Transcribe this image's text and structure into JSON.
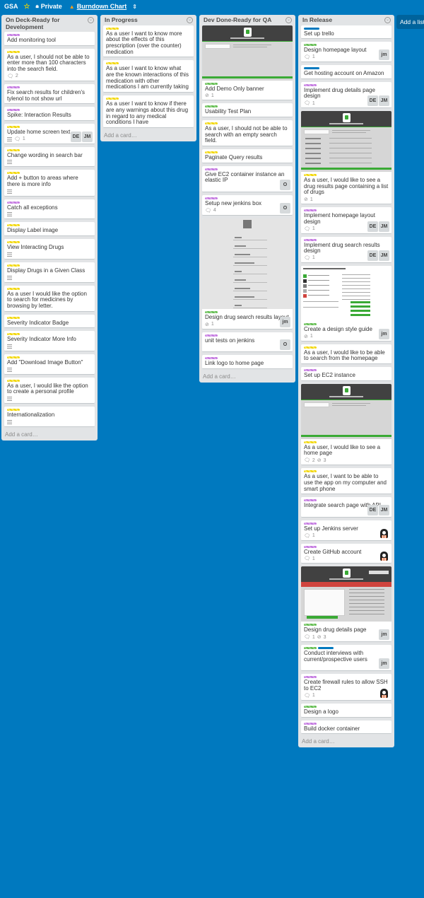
{
  "board": {
    "name": "GSA",
    "visibility": "Private",
    "burndown": "Burndown Chart",
    "add_list": "Add a list..."
  },
  "add_card_label": "Add a card…",
  "lists": [
    {
      "title": "On Deck-Ready for Development",
      "cards": [
        {
          "labels": [
            "purple"
          ],
          "title": "Add monitoring tool"
        },
        {
          "labels": [
            "yellow"
          ],
          "title": "As a user, I should not be able to enter more than 100 characters into the search field.",
          "badges": {
            "comments": "2"
          }
        },
        {
          "labels": [
            "purple"
          ],
          "title": "Fix search results for children's tylenol to not show url"
        },
        {
          "labels": [
            "purple"
          ],
          "title": "Spike: Interaction Results"
        },
        {
          "labels": [
            "yellow"
          ],
          "title": "Update home screen text",
          "badges": {
            "desc": true,
            "comments": "1"
          },
          "members": [
            "DE",
            "JM"
          ]
        },
        {
          "labels": [
            "yellow"
          ],
          "title": "Change wording in search bar",
          "badges": {
            "desc": true
          }
        },
        {
          "labels": [
            "yellow"
          ],
          "title": "Add + button to areas where there is more info",
          "badges": {
            "desc": true
          }
        },
        {
          "labels": [
            "purple"
          ],
          "title": "Catch all exceptions",
          "badges": {
            "desc": true
          }
        },
        {
          "labels": [
            "yellow"
          ],
          "title": "Display Label image"
        },
        {
          "labels": [
            "yellow"
          ],
          "title": "View Interacting Drugs",
          "badges": {
            "desc": true
          }
        },
        {
          "labels": [
            "yellow"
          ],
          "title": "Display Drugs in a Given Class",
          "badges": {
            "desc": true
          }
        },
        {
          "labels": [
            "yellow"
          ],
          "title": "As a user I would like the option to search for medicines by browsing by letter."
        },
        {
          "labels": [
            "yellow"
          ],
          "title": "Severity Indicator Badge"
        },
        {
          "labels": [
            "yellow"
          ],
          "title": "Severity Indicator More Info",
          "badges": {
            "desc": true
          }
        },
        {
          "labels": [
            "yellow"
          ],
          "title": "Add \"Download Image Button\"",
          "badges": {
            "desc": true
          }
        },
        {
          "labels": [
            "yellow"
          ],
          "title": "As a user, I would like the option to create a personal profile",
          "badges": {
            "desc": true
          }
        },
        {
          "labels": [
            "yellow"
          ],
          "title": "Internationalization",
          "badges": {
            "desc": true
          }
        }
      ]
    },
    {
      "title": "In Progress",
      "cards": [
        {
          "labels": [
            "yellow"
          ],
          "title": "As a user I want to know more about the effects of this prescription (over the counter) medication"
        },
        {
          "labels": [
            "yellow"
          ],
          "title": "As a user I want to know what are the known interactions of this medication with other medications I am currently taking"
        },
        {
          "labels": [
            "yellow"
          ],
          "title": "As a user I want to know if there are any warnings about this drug in regard to any medical conditions I have"
        }
      ]
    },
    {
      "title": "Dev Done-Ready for QA",
      "cards": [
        {
          "cover": "home",
          "labels": [
            "green"
          ],
          "title": "Add Demo Only banner",
          "badges": {
            "attach": "1"
          }
        },
        {
          "labels": [
            "green"
          ],
          "title": "Usability Test Plan"
        },
        {
          "labels": [
            "yellow"
          ],
          "title": "As a user, I should not be able to search with an empty search field."
        },
        {
          "labels": [
            "yellow"
          ],
          "title": "Paginate Query results"
        },
        {
          "labels": [
            "purple"
          ],
          "title": "Give EC2 container instance an elastic IP",
          "members": [
            "O"
          ]
        },
        {
          "labels": [
            "purple"
          ],
          "title": "Setup new jenkins box",
          "badges": {
            "comments": "4"
          },
          "members": [
            "O"
          ]
        },
        {
          "cover": "mobile",
          "labels": [
            "green"
          ],
          "title": "Design drug search results layout",
          "badges": {
            "attach": "1"
          },
          "members": [
            "jm"
          ]
        },
        {
          "labels": [
            "purple"
          ],
          "title": "unit tests on jenkins",
          "members": [
            "O"
          ]
        },
        {
          "labels": [
            "purple"
          ],
          "title": "Link logo to home page"
        }
      ]
    },
    {
      "title": "In Release",
      "cards": [
        {
          "labels": [
            "blue"
          ],
          "title": "Set up trello"
        },
        {
          "labels": [
            "green"
          ],
          "title": "Design homepage layout",
          "badges": {
            "comments": "1"
          },
          "members": [
            "jm"
          ]
        },
        {
          "labels": [
            "blue"
          ],
          "title": "Get hosting account on Amazon"
        },
        {
          "labels": [
            "purple"
          ],
          "title": "Implement drug details page design",
          "badges": {
            "comments": "1"
          },
          "members": [
            "DE",
            "JM"
          ]
        },
        {
          "cover": "results",
          "labels": [
            "yellow"
          ],
          "title": "As a user, I would like to see a drug results page containing a list of drugs",
          "badges": {
            "attach": "1"
          }
        },
        {
          "labels": [
            "purple"
          ],
          "title": "Implement homepage layout design",
          "badges": {
            "comments": "1"
          },
          "members": [
            "DE",
            "JM"
          ]
        },
        {
          "labels": [
            "purple"
          ],
          "title": "Implement drug search results design",
          "badges": {
            "comments": "1"
          },
          "members": [
            "DE",
            "JM"
          ]
        },
        {
          "cover": "style",
          "labels": [
            "green"
          ],
          "title": "Create a design style guide",
          "badges": {
            "attach": "1"
          },
          "members": [
            "jm"
          ]
        },
        {
          "labels": [
            "yellow"
          ],
          "title": "As a user, I would like to be able to search from the homepage"
        },
        {
          "labels": [
            "purple"
          ],
          "title": "Set up EC2 instance"
        },
        {
          "cover": "home",
          "labels": [
            "yellow"
          ],
          "title": "As a user, I would like to see a home page",
          "badges": {
            "comments": "2",
            "attach": "3"
          }
        },
        {
          "labels": [
            "yellow"
          ],
          "title": "As a user, I want to be able to use the app on my computer and smart phone"
        },
        {
          "labels": [
            "purple"
          ],
          "title": "Integrate search page with API",
          "members": [
            "DE",
            "JM"
          ]
        },
        {
          "labels": [
            "purple"
          ],
          "title": "Set up Jenkins server",
          "badges": {
            "comments": "1"
          },
          "members": [
            "avatar"
          ]
        },
        {
          "labels": [
            "purple"
          ],
          "title": "Create GitHub account",
          "badges": {
            "comments": "1"
          },
          "members": [
            "avatar"
          ]
        },
        {
          "cover": "details",
          "labels": [
            "green"
          ],
          "title": "Design drug details page",
          "badges": {
            "comments": "1",
            "attach": "3"
          },
          "members": [
            "jm"
          ]
        },
        {
          "labels": [
            "green",
            "blue"
          ],
          "title": "Conduct interviews with current/prospective users",
          "members": [
            "jm"
          ]
        },
        {
          "labels": [
            "purple"
          ],
          "title": "Create firewall rules to allow SSH to EC2",
          "badges": {
            "comments": "1"
          },
          "members": [
            "avatar"
          ]
        },
        {
          "labels": [
            "green"
          ],
          "title": "Design a logo"
        },
        {
          "labels": [
            "purple"
          ],
          "title": "Build docker container"
        }
      ]
    }
  ],
  "colors": {
    "board_bg": "#0079bf",
    "list_bg": "#e2e4e6",
    "label_purple": "#c377e0",
    "label_yellow": "#f2d600",
    "label_green": "#61bd4f",
    "label_blue": "#0079bf"
  },
  "icons": {
    "star": "star-icon",
    "lock": "lock-icon",
    "burndown": "fire-icon",
    "list_menu": "chevron-down-icon",
    "description": "description-icon",
    "comment": "comment-icon",
    "attachment": "paperclip-icon"
  }
}
